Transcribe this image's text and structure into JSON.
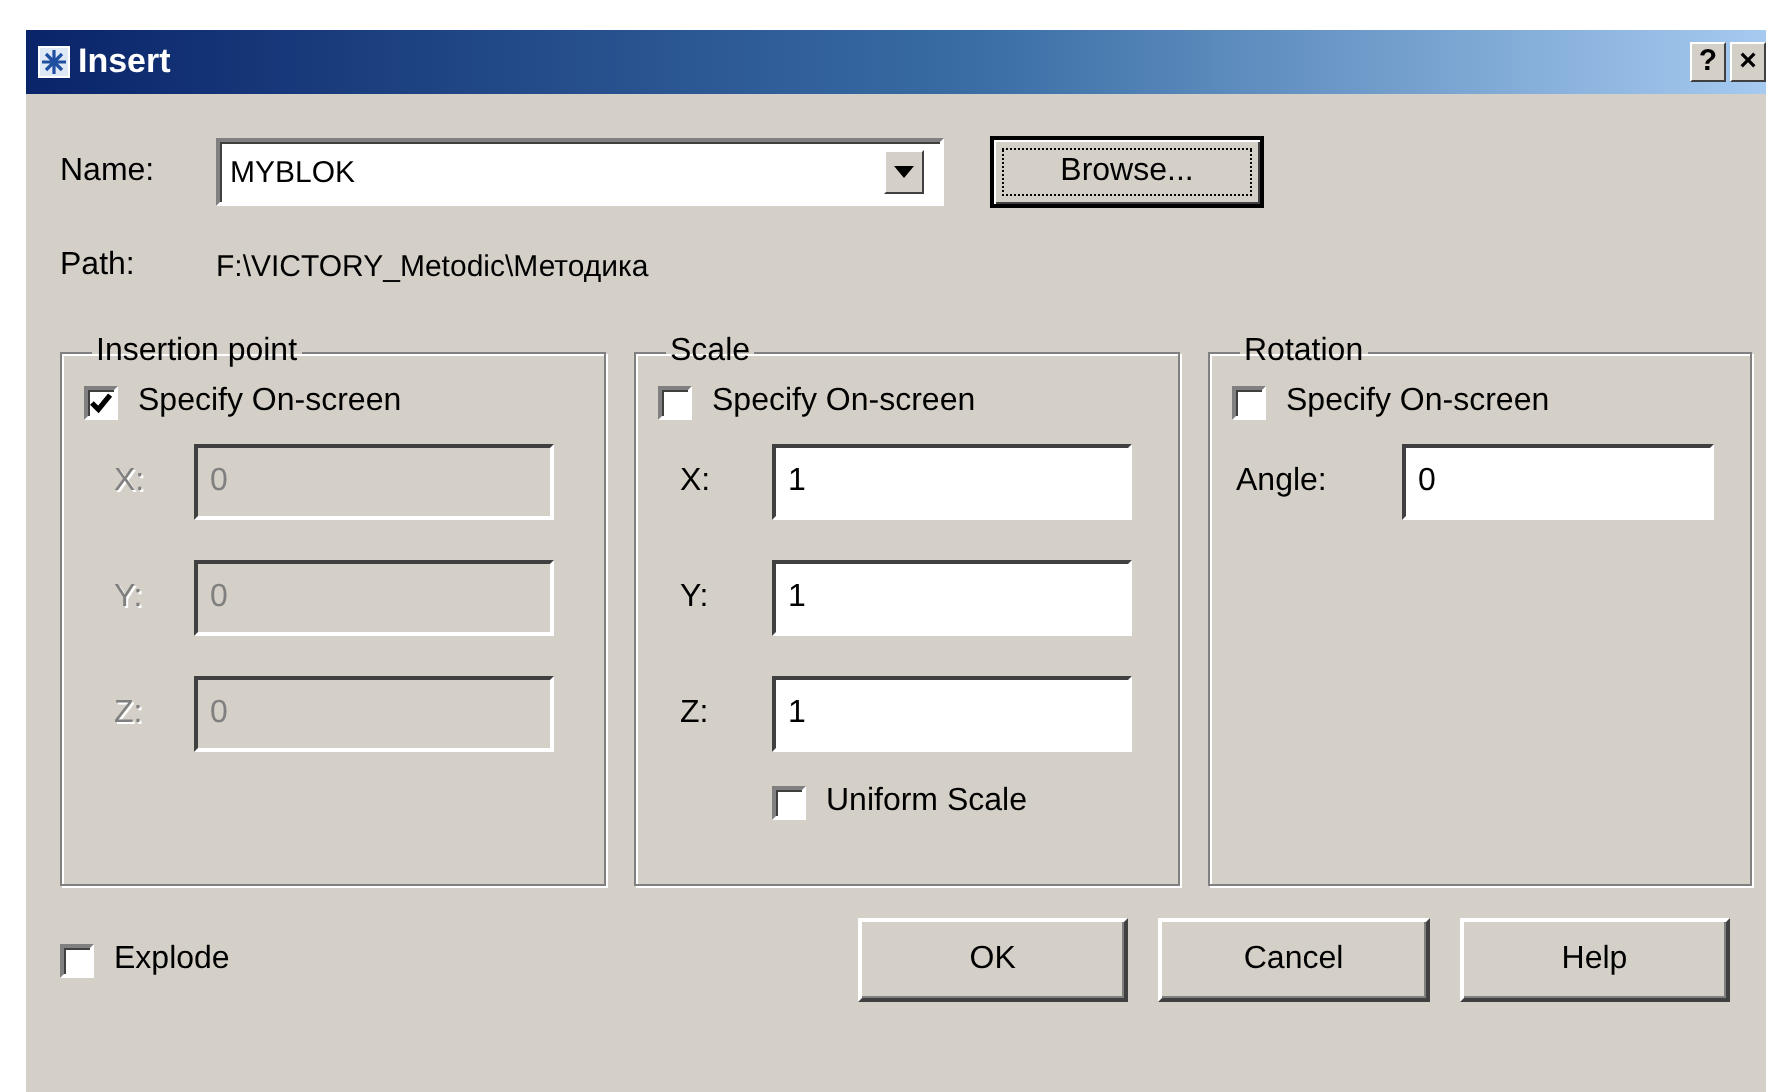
{
  "window": {
    "title": "Insert",
    "buttons": [
      "?",
      "×"
    ]
  },
  "name": {
    "label": "Name:",
    "value": "MYBLOK"
  },
  "browse_button": "Browse...",
  "path": {
    "label": "Path:",
    "value": "F:\\VICTORY_Metodic\\Методика"
  },
  "groups": [
    {
      "title": "Insertion point",
      "specify": {
        "label": "Specify On-screen",
        "checked": true
      },
      "fields": [
        {
          "label": "X:",
          "value": "0",
          "disabled": true
        },
        {
          "label": "Y:",
          "value": "0",
          "disabled": true
        },
        {
          "label": "Z:",
          "value": "0",
          "disabled": true
        }
      ]
    },
    {
      "title": "Scale",
      "specify": {
        "label": "Specify On-screen",
        "checked": false
      },
      "fields": [
        {
          "label": "X:",
          "value": "1",
          "disabled": false
        },
        {
          "label": "Y:",
          "value": "1",
          "disabled": false
        },
        {
          "label": "Z:",
          "value": "1",
          "disabled": false
        }
      ],
      "uniform": {
        "label": "Uniform Scale",
        "checked": false
      }
    },
    {
      "title": "Rotation",
      "specify": {
        "label": "Specify On-screen",
        "checked": false
      },
      "fields": [
        {
          "label": "Angle:",
          "value": "0",
          "disabled": false
        }
      ]
    }
  ],
  "explode": {
    "label": "Explode",
    "checked": false
  },
  "buttons": [
    "OK",
    "Cancel",
    "Help"
  ]
}
